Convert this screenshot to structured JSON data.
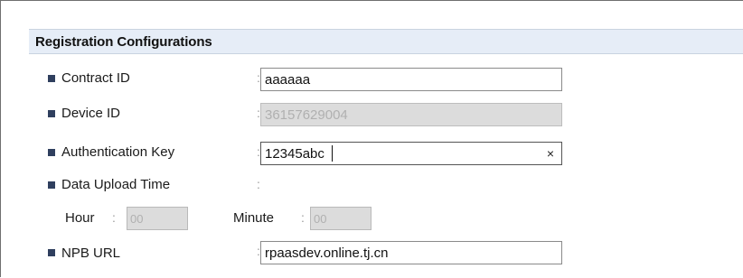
{
  "section": {
    "title": "Registration Configurations"
  },
  "fields": {
    "contract_id": {
      "label": "Contract ID",
      "value": "aaaaaa"
    },
    "device_id": {
      "label": "Device ID",
      "value": "36157629004"
    },
    "auth_key": {
      "label": "Authentication Key",
      "value": "12345abc",
      "clear_glyph": "×"
    },
    "upload_time": {
      "label": "Data Upload Time",
      "hour_label": "Hour",
      "hour_value": "00",
      "minute_label": "Minute",
      "minute_value": "00"
    },
    "npb_url": {
      "label": "NPB URL",
      "value": "rpaasdev.online.tj.cn"
    }
  },
  "separator": ":"
}
